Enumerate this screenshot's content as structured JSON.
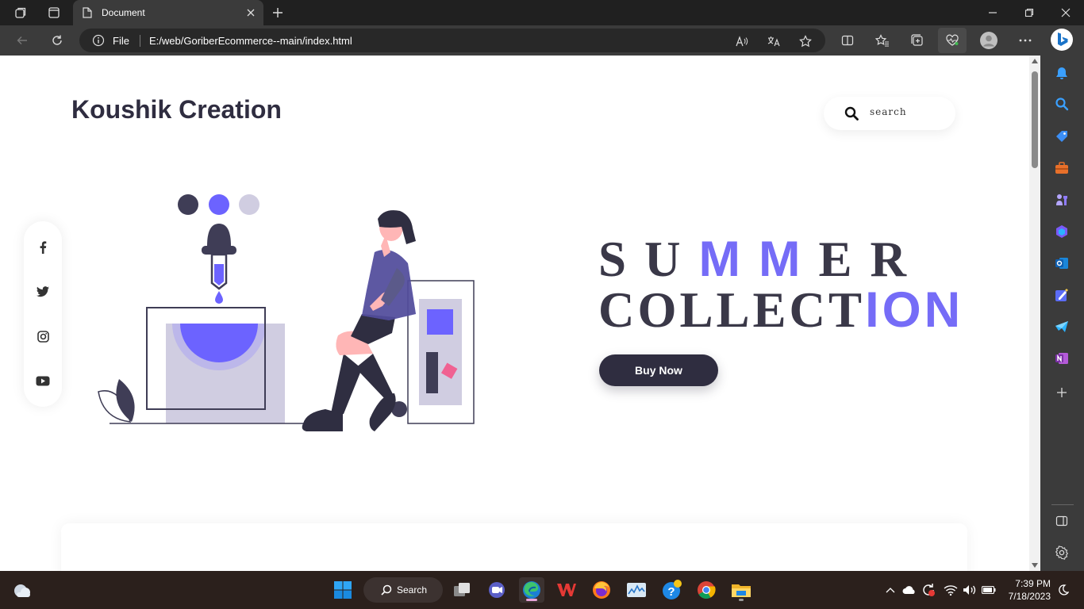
{
  "browser": {
    "tab_title": "Document",
    "address_protocol": "File",
    "address_url": "E:/web/GoriberEcommerce--main/index.html"
  },
  "page": {
    "brand": "Koushik Creation",
    "search_placeholder": "search",
    "headline_line1_part1": "SU",
    "headline_line1_accent": "MM",
    "headline_line1_part2": "ER",
    "headline_line2_part1": "COLLECT",
    "headline_line2_accent": "ION",
    "cta_label": "Buy Now",
    "social_icons": [
      "facebook-icon",
      "twitter-icon",
      "instagram-icon",
      "youtube-icon"
    ]
  },
  "taskbar": {
    "search_label": "Search",
    "time": "7:39 PM",
    "date": "7/18/2023"
  },
  "colors": {
    "accent": "#756cf7",
    "dark": "#2f2d40",
    "browser_chrome": "#3b3b3b",
    "tab_strip": "#202020",
    "taskbar": "#2b201c"
  }
}
